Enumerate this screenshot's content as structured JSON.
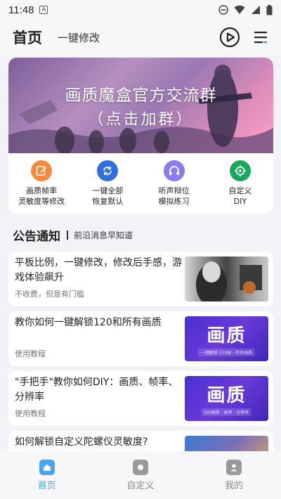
{
  "status": {
    "time": "11:48",
    "badge": "A"
  },
  "header": {
    "title": "首页",
    "subtitle": "一键修改"
  },
  "banner": {
    "line1": "画质魔盒官方交流群",
    "line2": "（点击加群）"
  },
  "quick_actions": [
    {
      "label1": "画质帧率",
      "label2": "灵敏度等修改",
      "icon": "edit-icon",
      "color": "#f58a3c"
    },
    {
      "label1": "一键全部",
      "label2": "恢复默认",
      "icon": "refresh-icon",
      "color": "#2f6fe0"
    },
    {
      "label1": "听声辩位",
      "label2": "模拟练习",
      "icon": "headphones-icon",
      "color": "#8b7bf0"
    },
    {
      "label1": "自定义",
      "label2": "DIY",
      "icon": "crosshair-icon",
      "color": "#18a95b"
    }
  ],
  "section": {
    "title": "公告通知",
    "subtitle": "前沿消息早知道"
  },
  "news": [
    {
      "text": "平板比例，一键修改，修改后手感，游戏体验飙升",
      "sub": "不收费，但是有门槛"
    },
    {
      "text": "教你如何一键解锁120和所有画质",
      "sub": "使用教程",
      "thumb_text": "画质",
      "thumb_small": "一键解锁 120帧 · 所有画质"
    },
    {
      "text": "\"手把手\"教你如何DIY：画质、帧率、分辨率",
      "sub": "使用教程",
      "thumb_text": "画质",
      "thumb_small": "DIY画质 · 帧率 · 分辨率"
    },
    {
      "text": "如何解锁自定义陀螺仪灵敏度?",
      "sub": ""
    }
  ],
  "tabbar": [
    {
      "label": "首页",
      "active": true
    },
    {
      "label": "自定义",
      "active": false
    },
    {
      "label": "我的",
      "active": false
    }
  ],
  "colors": {
    "accent": "#4aa3f0",
    "inactive": "#888888"
  }
}
